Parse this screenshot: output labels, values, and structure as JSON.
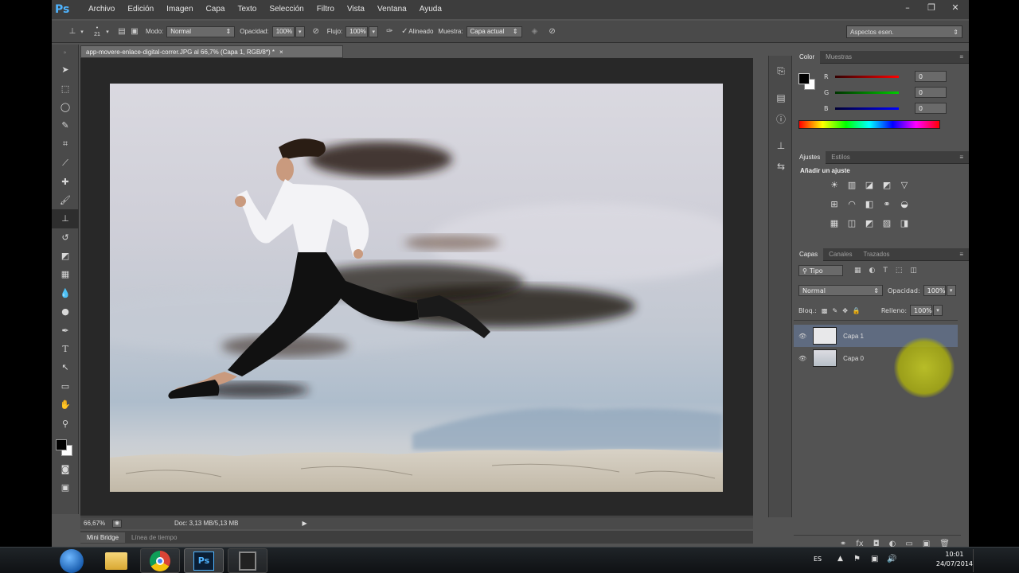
{
  "menubar": {
    "logo": "Ps",
    "items": [
      "Archivo",
      "Edición",
      "Imagen",
      "Capa",
      "Texto",
      "Selección",
      "Filtro",
      "Vista",
      "Ventana",
      "Ayuda"
    ],
    "window_buttons": [
      "–",
      "❐",
      "✕"
    ]
  },
  "options": {
    "brush_size": "21",
    "mode_label": "Modo:",
    "mode_value": "Normal",
    "opacity_label": "Opacidad:",
    "opacity_value": "100%",
    "flow_label": "Flujo:",
    "flow_value": "100%",
    "aligned_label": "Alineado",
    "sample_label": "Muestra:",
    "sample_value": "Capa actual",
    "workspace_value": "Aspectos esen."
  },
  "document": {
    "tab_title": "app-movere-enlace-digital-correr.JPG al 66,7% (Capa 1, RGB/8*) *",
    "tab_close": "×",
    "zoom": "66,67%",
    "doc_size": "Doc: 3,13 MB/5,13 MB"
  },
  "bottom_tabs": [
    "Mini Bridge",
    "Línea de tiempo"
  ],
  "color_panel": {
    "tabs": [
      "Color",
      "Muestras"
    ],
    "channels": [
      {
        "label": "R",
        "value": "0",
        "color": "#d01010"
      },
      {
        "label": "G",
        "value": "0",
        "color": "#10b010"
      },
      {
        "label": "B",
        "value": "0",
        "color": "#1030d0"
      }
    ]
  },
  "adjustments_panel": {
    "tabs": [
      "Ajustes",
      "Estilos"
    ],
    "heading": "Añadir un ajuste",
    "icons": [
      "☀",
      "▥",
      "◪",
      "◩",
      "▽",
      "⊞",
      "◠",
      "◧",
      "⚭",
      "◒",
      "▦",
      "◫",
      "◩",
      "▨",
      "◨"
    ]
  },
  "layers_panel": {
    "tabs": [
      "Capas",
      "Canales",
      "Trazados"
    ],
    "filter_value": "Tipo",
    "blend_value": "Normal",
    "opacity_label": "Opacidad:",
    "opacity_value": "100%",
    "lock_label": "Bloq.:",
    "fill_label": "Relleno:",
    "fill_value": "100%",
    "layers": [
      "Capa 1",
      "Capa 0"
    ],
    "footer_icons": [
      "⚭",
      "fx",
      "◘",
      "◐",
      "▭",
      "▣",
      "🗑"
    ]
  },
  "taskbar": {
    "lang": "ES",
    "time": "10:01",
    "date": "24/07/2014"
  }
}
